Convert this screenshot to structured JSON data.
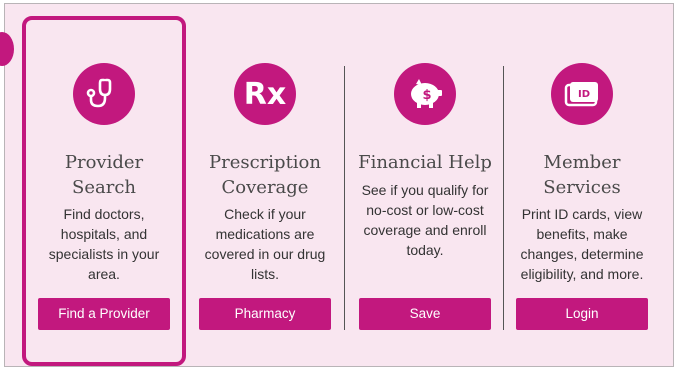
{
  "colors": {
    "accent": "#c2187e",
    "panel_bg": "#f9e6f0"
  },
  "cards": [
    {
      "icon": "stethoscope-icon",
      "title_line1": "Provider",
      "title_line2": "Search",
      "desc_lines": [
        "Find doctors,",
        "hospitals, and",
        "specialists in your",
        "area."
      ],
      "button": "Find a Provider"
    },
    {
      "icon": "rx-icon",
      "icon_text": "Rx",
      "title_line1": "Prescription",
      "title_line2": "Coverage",
      "desc_lines": [
        "Check if your",
        "medications are",
        "covered in our drug",
        "lists."
      ],
      "button": "Pharmacy"
    },
    {
      "icon": "piggy-bank-icon",
      "icon_text": "$",
      "title_line1": "Financial Help",
      "desc_lines": [
        "See if you qualify for",
        "no-cost or low-cost",
        "coverage and enroll",
        "today."
      ],
      "button": "Save"
    },
    {
      "icon": "id-card-icon",
      "icon_text": "ID",
      "title_line1": "Member",
      "title_line2": "Services",
      "desc_lines": [
        "Print ID cards, view",
        "benefits, make",
        "changes, determine",
        "eligibility, and more."
      ],
      "button": "Login"
    }
  ]
}
